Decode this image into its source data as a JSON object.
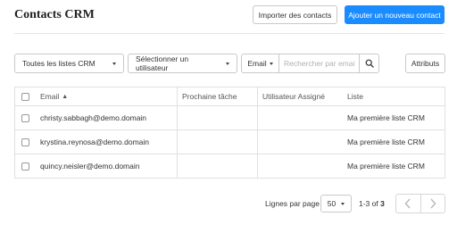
{
  "header": {
    "title": "Contacts CRM",
    "import_label": "Importer des contacts",
    "add_label": "Ajouter un nouveau contact",
    "accent_color": "#1a8cff"
  },
  "filters": {
    "lists_selected": "Toutes les listes CRM",
    "user_selected": "Sélectionner un utilisateur",
    "field_selected": "Email",
    "search_placeholder": "Rechercher par email",
    "search_value": "",
    "search_icon": "magnifier-icon",
    "attributes_label": "Attributs"
  },
  "table": {
    "columns": [
      "Email",
      "Prochaine tâche",
      "Utilisateur Assigné",
      "Liste"
    ],
    "sort_indicator": "▲",
    "rows": [
      {
        "email": "christy.sabbagh@demo.domain",
        "next_task": "",
        "assigned_user": "",
        "list": "Ma première liste CRM"
      },
      {
        "email": "krystina.reynosa@demo.domain",
        "next_task": "",
        "assigned_user": "",
        "list": "Ma première liste CRM"
      },
      {
        "email": "quincy.neisler@demo.domain",
        "next_task": "",
        "assigned_user": "",
        "list": "Ma première liste CRM"
      }
    ]
  },
  "pagination": {
    "rows_per_page_label": "Lignes par page",
    "rows_per_page": "50",
    "range_text": "1-3",
    "range_of": "of",
    "total": "3",
    "prev_icon": "chevron-left-icon",
    "next_icon": "chevron-right-icon"
  }
}
